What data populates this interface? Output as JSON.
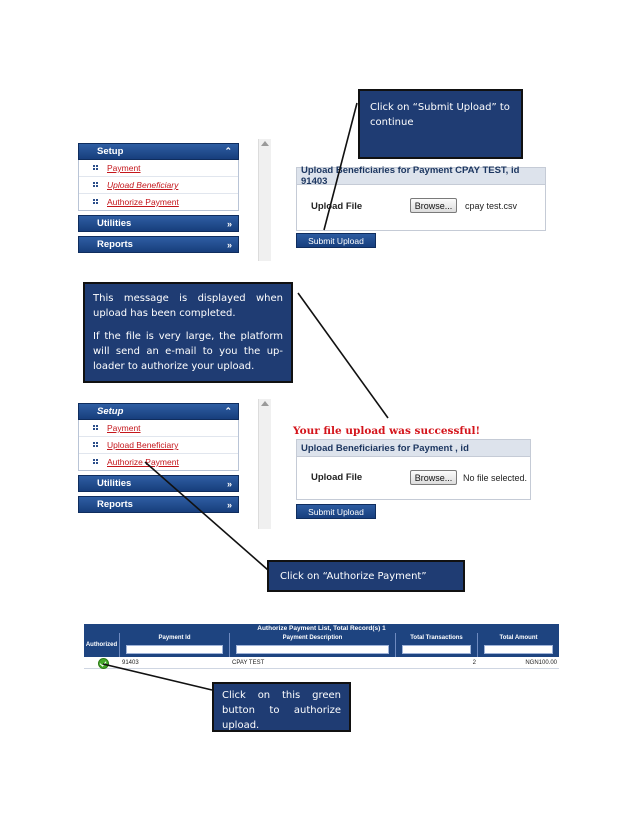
{
  "callouts": {
    "submit_upload": "Click on “Submit Upload” to continue",
    "message_p1": "This message is displayed when upload has been completed.",
    "message_p2": "If the file is very large, the platform will send an e-mail to you the up-loader to authorize your upload.",
    "authorize_payment": "Click on “Authorize Payment”",
    "green_button": "Click on this green button to authorize upload."
  },
  "menu": {
    "setup": "Setup",
    "items": [
      "Payment",
      "Upload Beneficiary",
      "Authorize Payment"
    ],
    "utilities": "Utilities",
    "reports": "Reports"
  },
  "upload1": {
    "title": "Upload Beneficiaries for Payment CPAY TEST, id 91403",
    "label": "Upload File",
    "browse": "Browse...",
    "file": "cpay test.csv",
    "submit": "Submit Upload"
  },
  "upload2": {
    "success": "Your file upload was successful!",
    "title": "Upload Beneficiaries for Payment , id",
    "label": "Upload File",
    "browse": "Browse...",
    "file": "No file selected.",
    "submit": "Submit Upload"
  },
  "table": {
    "title": "Authorize Payment List, Total Record(s) 1",
    "headers": [
      "Authorized",
      "Payment Id",
      "Payment Description",
      "Total Transactions",
      "Total Amount"
    ],
    "row": [
      "91403",
      "CPAY TEST",
      "2",
      "NGN100.00"
    ]
  },
  "colors": {
    "navy": "#1f3c73",
    "link_red": "#c4161c",
    "success_green": "#45a82a"
  }
}
